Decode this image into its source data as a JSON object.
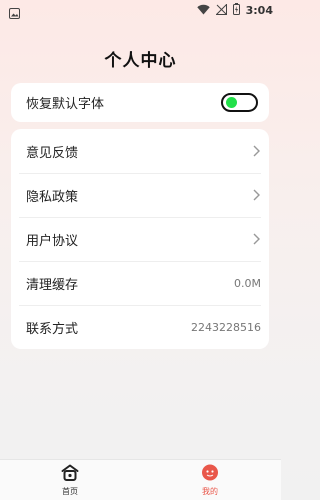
{
  "status": {
    "time": "3:04"
  },
  "page_title": "个人中心",
  "settings": {
    "restore_font_label": "恢复默认字体",
    "restore_font_enabled": true
  },
  "menu": {
    "feedback": "意见反馈",
    "privacy": "隐私政策",
    "agreement": "用户协议",
    "clear_cache": "清理缓存",
    "cache_size": "0.0M",
    "contact": "联系方式",
    "contact_value": "2243228516"
  },
  "tabbar": {
    "home": "首页",
    "mine": "我的"
  },
  "colors": {
    "toggle_on": "#22e04a",
    "tab_active": "#e9574a"
  }
}
